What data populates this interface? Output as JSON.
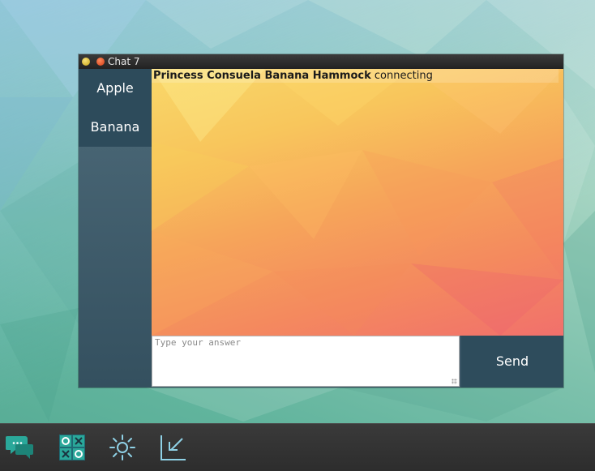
{
  "window": {
    "title": "Chat 7"
  },
  "sidebar": {
    "items": [
      {
        "label": "Apple"
      },
      {
        "label": "Banana"
      }
    ]
  },
  "chat": {
    "messages": [
      {
        "sender": "Princess Consuela Banana Hammock",
        "text": "connecting"
      }
    ]
  },
  "composer": {
    "placeholder": "Type your answer",
    "value": "",
    "send_label": "Send"
  },
  "taskbar": {
    "icons": [
      "chat-icon",
      "tic-tac-toe-icon",
      "sun-icon",
      "minimize-arrow-icon"
    ]
  },
  "colors": {
    "sidebar": "#2d4b5b",
    "send_button": "#2e4c5c",
    "taskbar": "#333333",
    "chat_icon": "#2aa89a"
  }
}
